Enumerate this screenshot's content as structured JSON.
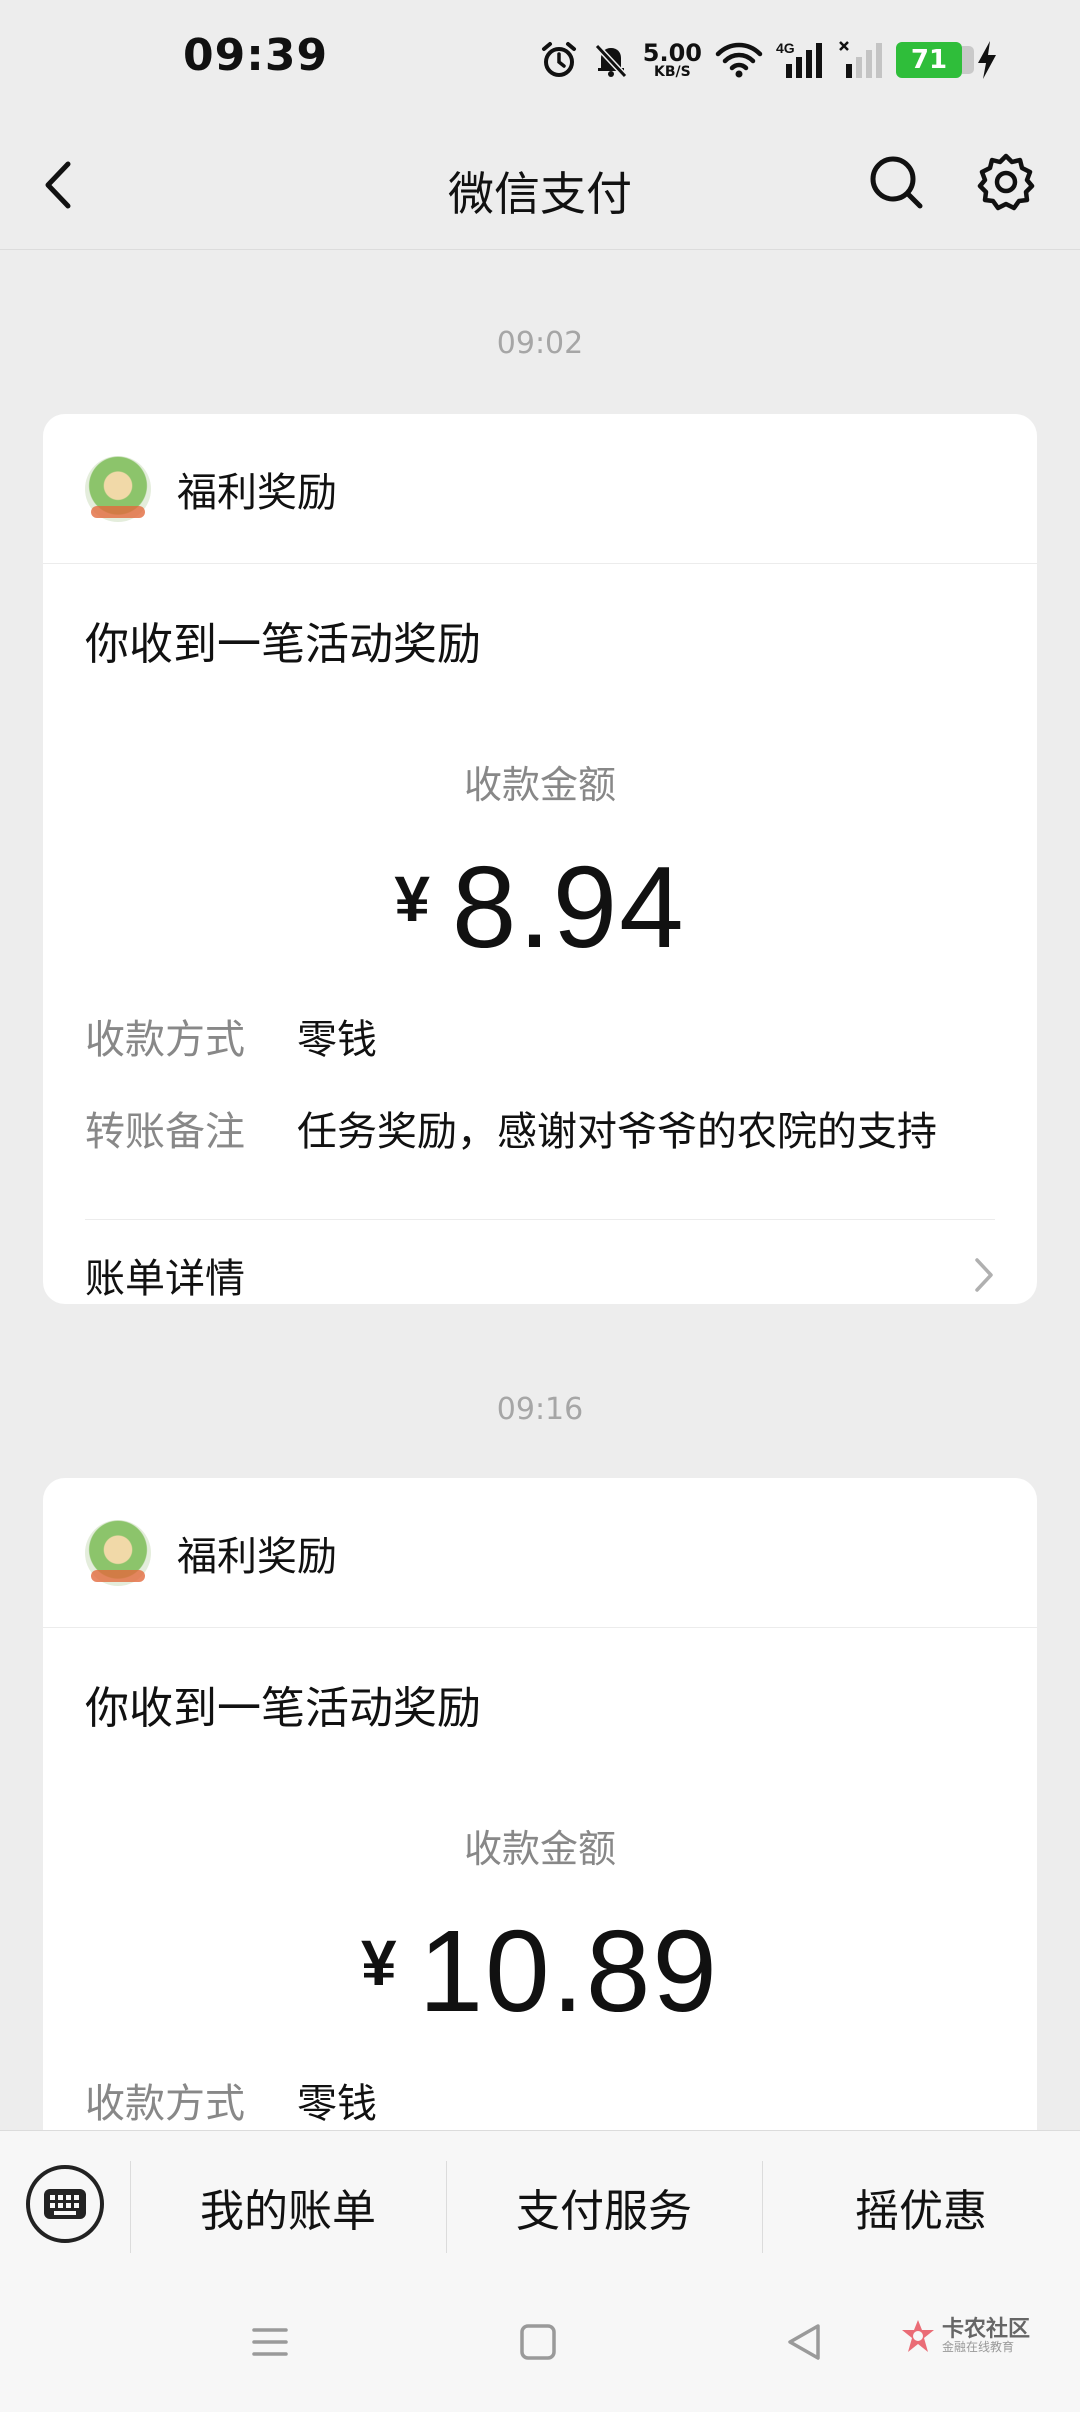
{
  "status_bar": {
    "time": "09:39",
    "net_speed_value": "5.00",
    "net_speed_unit": "KB/S",
    "network_type": "4G",
    "battery_level": "71"
  },
  "nav": {
    "title": "微信支付",
    "icons": [
      "back-icon",
      "search-icon",
      "settings-icon"
    ]
  },
  "messages": [
    {
      "timestamp": "09:02",
      "brand": "福利奖励",
      "headline": "你收到一笔活动奖励",
      "amount_label": "收款金额",
      "currency": "¥",
      "amount": "8.94",
      "method_key": "收款方式",
      "method_value": "零钱",
      "remark_key": "转账备注",
      "remark_value": "任务奖励，感谢对爷爷的农院的支持",
      "detail_label": "账单详情"
    },
    {
      "timestamp": "09:16",
      "brand": "福利奖励",
      "headline": "你收到一笔活动奖励",
      "amount_label": "收款金额",
      "currency": "¥",
      "amount": "10.89",
      "method_key": "收款方式",
      "method_value": "零钱"
    }
  ],
  "bottom_bar": {
    "items": [
      "我的账单",
      "支付服务",
      "摇优惠"
    ]
  },
  "watermark": {
    "title": "卡农社区",
    "subtitle": "金融在线教育"
  },
  "colors": {
    "background": "#ededed",
    "card": "#ffffff",
    "battery": "#2fbe3a",
    "muted_text": "#888888"
  }
}
